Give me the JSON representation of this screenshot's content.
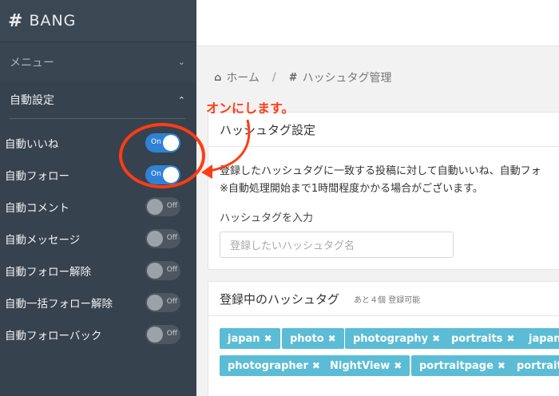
{
  "brand": {
    "icon": "#",
    "name": "BANG"
  },
  "sidebar": {
    "menu_label": "メニュー",
    "settings_label": "自動設定",
    "toggles": [
      {
        "label": "自動いいね",
        "state": "On",
        "on": true
      },
      {
        "label": "自動フォロー",
        "state": "On",
        "on": true
      },
      {
        "label": "自動コメント",
        "state": "Off",
        "on": false
      },
      {
        "label": "自動メッセージ",
        "state": "Off",
        "on": false
      },
      {
        "label": "自動フォロー解除",
        "state": "Off",
        "on": false
      },
      {
        "label": "自動一括フォロー解除",
        "state": "Off",
        "on": false
      },
      {
        "label": "自動フォローバック",
        "state": "Off",
        "on": false
      }
    ]
  },
  "breadcrumb": {
    "home": "ホーム",
    "separator": "/",
    "current": "ハッシュタグ管理"
  },
  "annotation": "オンにします。",
  "settings_card": {
    "title": "ハッシュタグ設定",
    "desc1": "登録したハッシュタグに一致する投稿に対して自動いいね、自動フォ",
    "desc2": "※自動処理開始まで1時間程度かかる場合がございます。",
    "input_label": "ハッシュタグを入力",
    "input_placeholder": "登録したいハッシュタグ名"
  },
  "registered_card": {
    "title": "登録中のハッシュタグ",
    "hint": "あと４個 登録可能",
    "tags": [
      "japan",
      "photo",
      "photography",
      "portraits",
      "japan",
      "photographer",
      "NightView",
      "portraitpage",
      "portraitp"
    ]
  },
  "colors": {
    "sidebar": "#37424f",
    "toggle_on": "#2f82d6",
    "tag": "#5bbcd6",
    "annotation": "#ff3c14"
  }
}
